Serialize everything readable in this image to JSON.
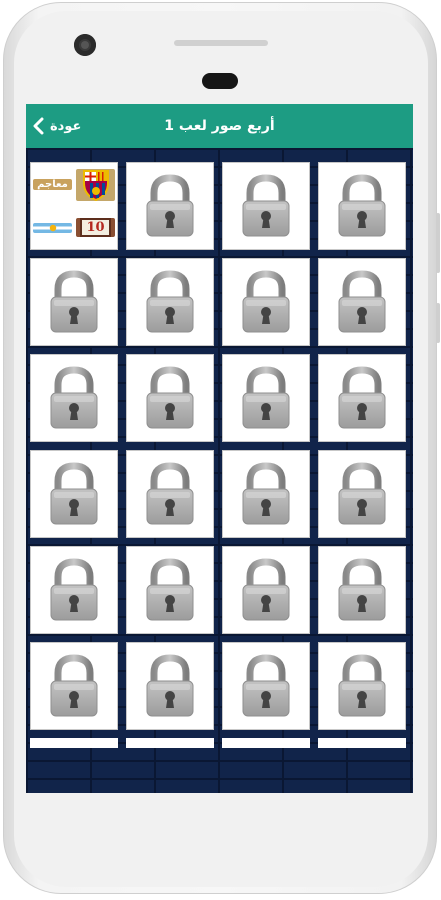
{
  "app_bar": {
    "title": "أربع صور لعب 1",
    "back_label": "عودة"
  },
  "thumbnails": {
    "text_tile": "معاجم",
    "number_tile": "10"
  },
  "levels": {
    "total_visible": 24,
    "unlocked": 1,
    "locked_icon": "padlock-icon"
  },
  "colors": {
    "app_bar": "#1d9c83",
    "background": "#11244a",
    "lock": "#a9a9a9"
  }
}
